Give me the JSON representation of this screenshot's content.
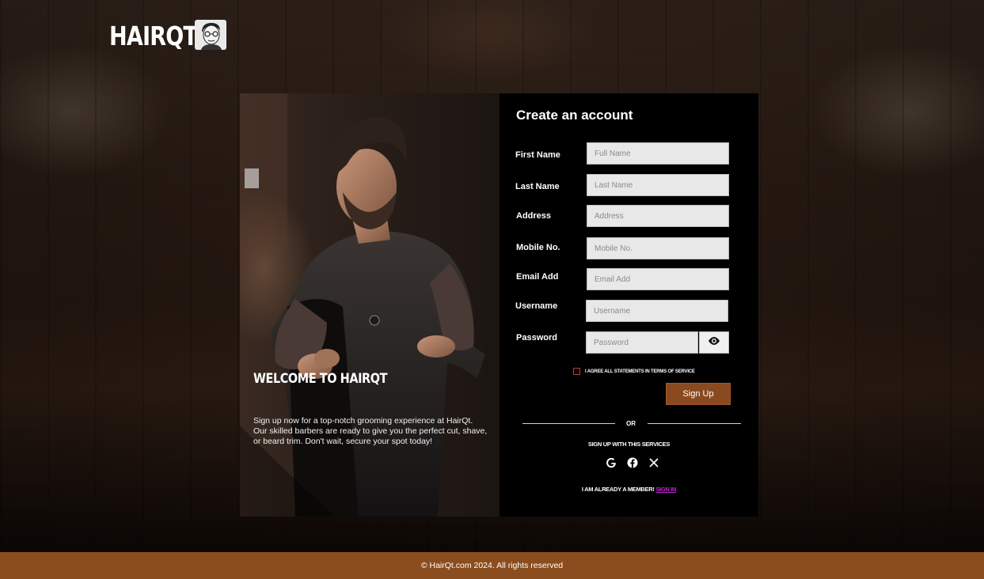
{
  "header": {
    "logo_text": "HAIRQT",
    "avatar_icon": "cartoon-avatar"
  },
  "hero": {
    "title": "WELCOME TO HAIRQT",
    "description": "Sign up now for a top-notch grooming experience at HairQt. Our skilled barbers are ready to give you the perfect cut, shave, or beard trim. Don't wait, secure your spot today!"
  },
  "form": {
    "title": "Create an account",
    "fields": {
      "first_name": {
        "label": "First Name",
        "placeholder": "Full Name"
      },
      "last_name": {
        "label": "Last Name",
        "placeholder": "Last Name"
      },
      "address": {
        "label": "Address",
        "placeholder": "Address"
      },
      "mobile": {
        "label": "Mobile No.",
        "placeholder": "Mobile No."
      },
      "email": {
        "label": "Email Add",
        "placeholder": "Email Add"
      },
      "username": {
        "label": "Username",
        "placeholder": "Username"
      },
      "password": {
        "label": "Password",
        "placeholder": "Password"
      }
    },
    "agree_text": "I agree all statements in terms of service",
    "signup_button": "Sign Up",
    "or_text": "OR",
    "services_text": "Sign up with this services",
    "social_icons": [
      "google-icon",
      "facebook-icon",
      "x-icon"
    ],
    "member_text": "I am already a member!",
    "signin_link": "Sign in"
  },
  "footer": {
    "copyright": "© HairQt.com 2024. All rights reserved"
  },
  "colors": {
    "accent": "#8a4a1f",
    "footer": "#8b4d1e",
    "panel": "#000000",
    "link": "#c026d3"
  }
}
